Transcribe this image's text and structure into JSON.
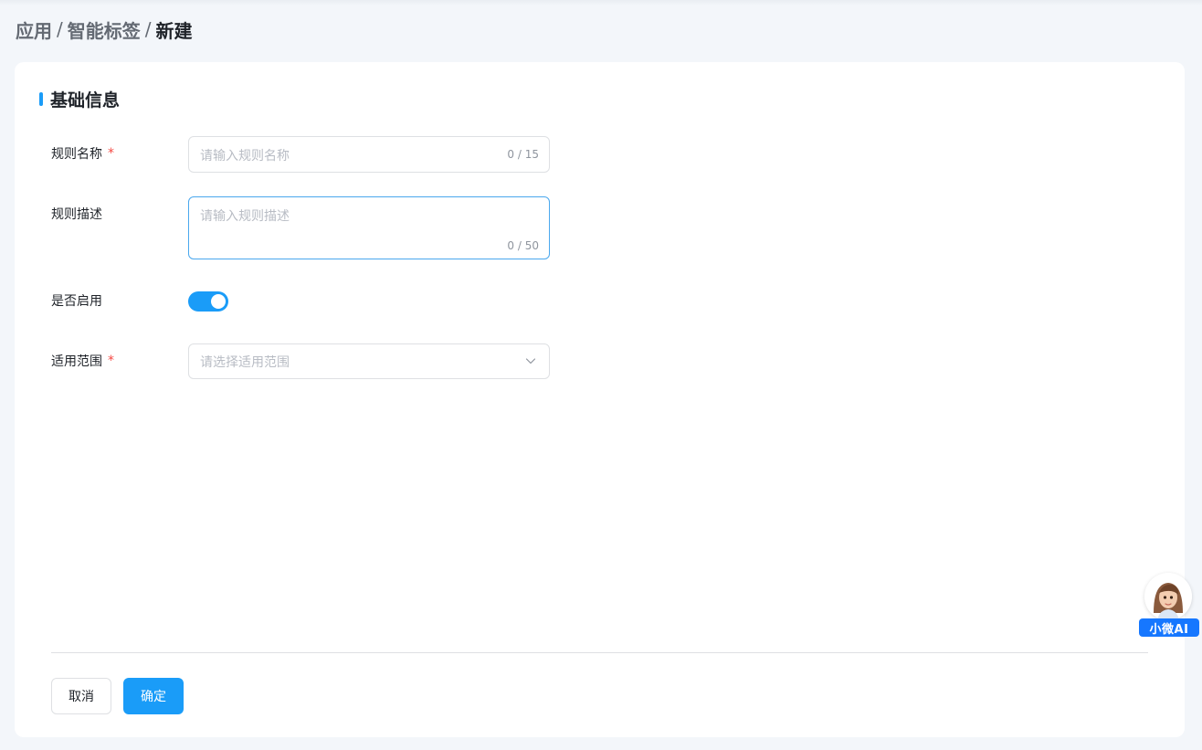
{
  "breadcrumb": {
    "items": [
      "应用",
      "智能标签"
    ],
    "separator": "/",
    "current": "新建"
  },
  "section": {
    "title": "基础信息"
  },
  "form": {
    "rule_name": {
      "label": "规则名称",
      "required_mark": "*",
      "placeholder": "请输入规则名称",
      "value": "",
      "counter": "0 / 15"
    },
    "rule_desc": {
      "label": "规则描述",
      "placeholder": "请输入规则描述",
      "value": "",
      "counter": "0 / 50"
    },
    "enabled": {
      "label": "是否启用",
      "on": true
    },
    "scope": {
      "label": "适用范围",
      "required_mark": "*",
      "placeholder": "请选择适用范围",
      "icon": "chevron-down-icon"
    }
  },
  "actions": {
    "cancel_label": "取消",
    "confirm_label": "确定"
  },
  "assistant": {
    "label": "小微AI",
    "icon": "assistant-avatar-icon"
  },
  "colors": {
    "accent": "#1a9cf8",
    "required": "#f54a45",
    "page_bg": "#f3f6fa",
    "assistant_badge": "#1677ff"
  }
}
